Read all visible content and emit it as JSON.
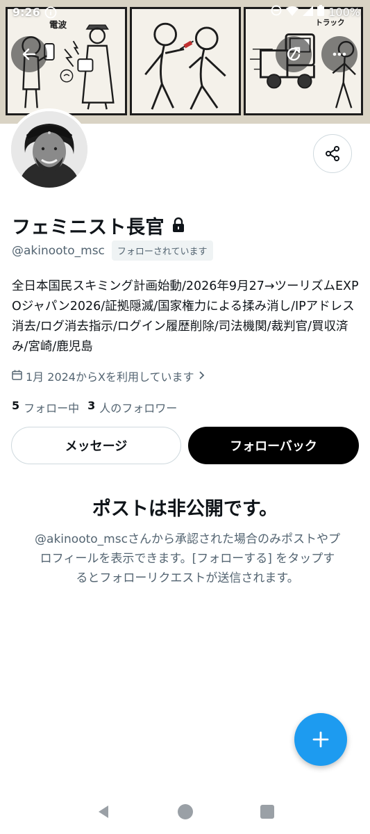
{
  "status_bar": {
    "time": "9:26",
    "battery": "100%",
    "icons": [
      "info-icon",
      "do-not-disturb-icon",
      "wifi-icon",
      "signal-icon",
      "battery-icon"
    ]
  },
  "banner": {
    "panel1_label": "電波",
    "panel3_label": "トラック"
  },
  "header_actions": [
    "back-arrow-icon",
    "refresh-icon",
    "more-icon"
  ],
  "profile": {
    "display_name": "フェミニスト長官",
    "locked_icon": "lock-icon",
    "handle": "@akinooto_msc",
    "follows_you_badge": "フォローされています",
    "bio": "全日本国民スキミング計画始動/2026年9月27→ツーリズムEXPOジャパン2026/証拠隠滅/国家権力による揉み消し/IPアドレス消去/ログ消去指示/ログイン履歴削除/司法機関/裁判官/買収済み/宮崎/鹿児島",
    "joined": "1月 2024からXを利用しています",
    "following_count": "5",
    "following_label": "フォロー中",
    "followers_count": "3",
    "followers_label": "人のフォロワー"
  },
  "actions": {
    "message_label": "メッセージ",
    "follow_back_label": "フォローバック"
  },
  "private_notice": {
    "title": "ポストは非公開です。",
    "body": "@akinooto_mscさんから承認された場合のみポストやプロフィールを表示できます。[フォローする] をタップするとフォローリクエストが送信されます。"
  },
  "colors": {
    "accent": "#1d9bf0",
    "text_primary": "#0f1419",
    "text_secondary": "#536471",
    "button_dark": "#000000",
    "border": "#cfd9de"
  }
}
